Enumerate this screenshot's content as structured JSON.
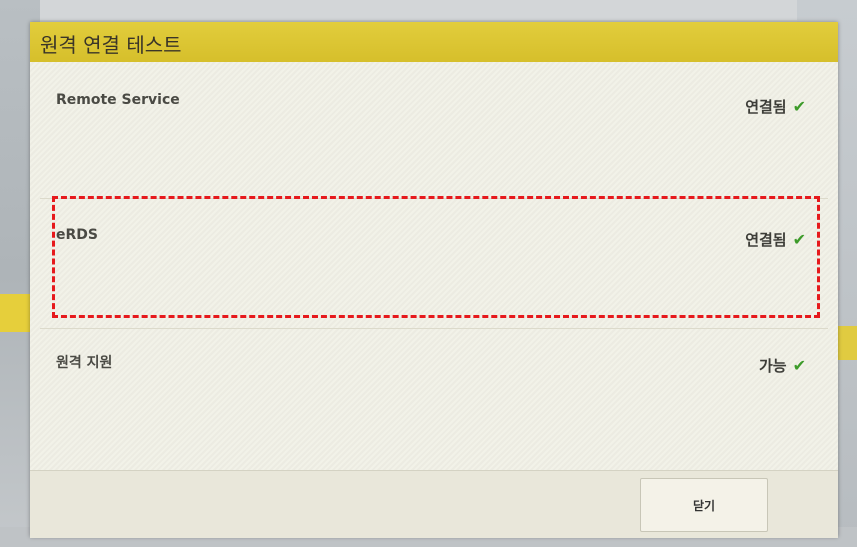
{
  "dialog": {
    "title": "원격 연결 테스트",
    "rows": [
      {
        "label": "Remote Service",
        "status": "연결됨"
      },
      {
        "label": "eRDS",
        "status": "연결됨"
      },
      {
        "label": "원격 지원",
        "status": "가능"
      }
    ],
    "close_label": "닫기"
  },
  "icons": {
    "status_check": "checkmark-icon"
  },
  "colors": {
    "header": "#d9c232",
    "check": "#3d9b2a",
    "highlight": "#e6191c"
  }
}
